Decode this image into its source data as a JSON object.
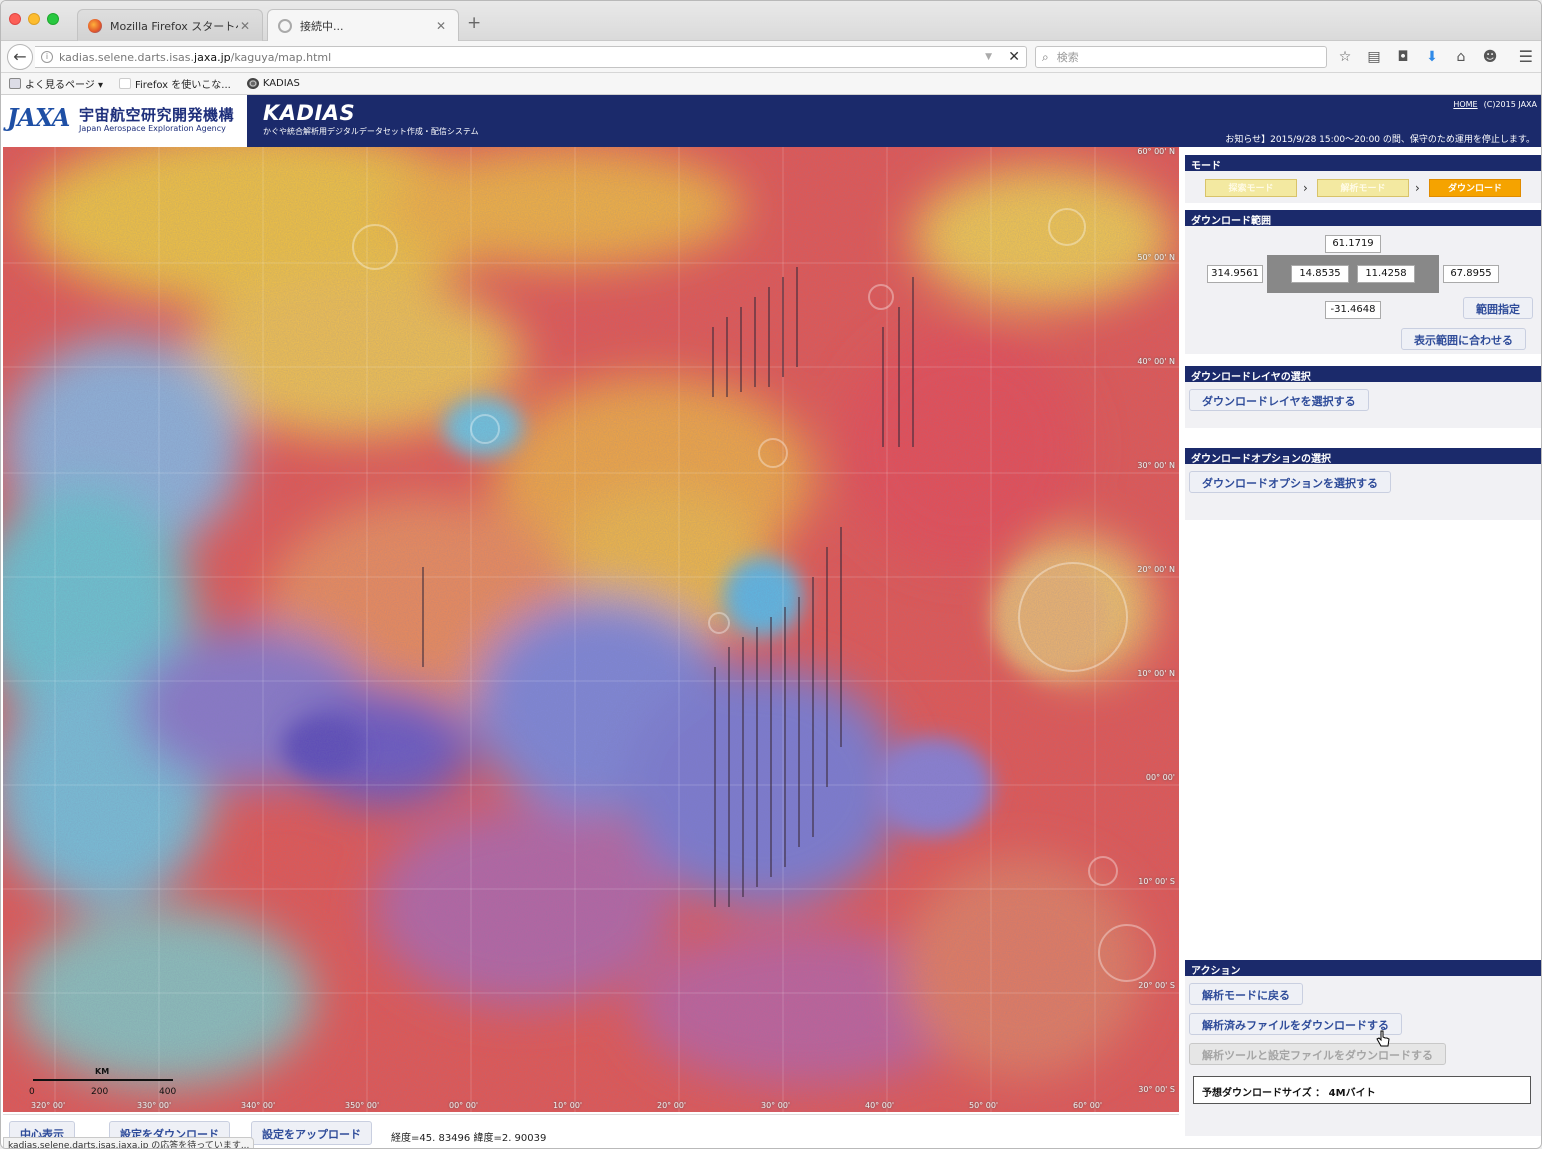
{
  "browser": {
    "tabs": [
      {
        "label": "Mozilla Firefox スタートページ"
      },
      {
        "label": "接続中..."
      }
    ],
    "url_prefix": "kadias.selene.darts.isas.",
    "url_domain": "jaxa.jp",
    "url_suffix": "/kaguya/map.html",
    "search_placeholder": "検索",
    "bookmarks": [
      "よく見るページ ▾",
      "Firefox を使いこな...",
      "KADIAS"
    ],
    "status_text": "kadias.selene.darts.isas.jaxa.jp の応答を待っています..."
  },
  "header": {
    "jaxa_jp": "宇宙航空研究開発機構",
    "jaxa_en": "Japan Aerospace Exploration Agency",
    "title": "KADIAS",
    "subtitle": "かぐや統合解析用デジタルデータセット作成・配信システム",
    "home_link": "HOME",
    "copyright": "(C)2015 JAXA",
    "notice": "お知らせ】2015/9/28 15:00～20:00 の間、保守のため運用を停止します。"
  },
  "map": {
    "lat_labels": [
      "60° 00' N",
      "50° 00' N",
      "40° 00' N",
      "30° 00' N",
      "20° 00' N",
      "10° 00' N",
      "00° 00'",
      "10° 00' S",
      "20° 00' S",
      "30° 00' S"
    ],
    "lon_labels": [
      "320° 00'",
      "330° 00'",
      "340° 00'",
      "350° 00'",
      "00° 00'",
      "10° 00'",
      "20° 00'",
      "30° 00'",
      "40° 00'",
      "50° 00'",
      "60° 00'"
    ],
    "scale_unit": "KM",
    "scale_ticks": [
      "0",
      "200",
      "400"
    ]
  },
  "bottom": {
    "center_btn": "中心表示",
    "download_settings_btn": "設定をダウンロード",
    "upload_settings_btn": "設定をアップロード",
    "coords": "経度=45. 83496  緯度=2. 90039"
  },
  "panel": {
    "mode_title": "モード",
    "modes": [
      "探索モード",
      "解析モード",
      "ダウンロード"
    ],
    "range_title": "ダウンロード範囲",
    "range": {
      "north": "61.1719",
      "west": "314.9561",
      "center_lon": "14.8535",
      "center_lat": "11.4258",
      "east": "67.8955",
      "south": "-31.4648"
    },
    "range_btn": "範囲指定",
    "fit_btn": "表示範囲に合わせる",
    "layer_title": "ダウンロードレイヤの選択",
    "layer_btn": "ダウンロードレイヤを選択する",
    "option_title": "ダウンロードオプションの選択",
    "option_btn": "ダウンロードオプションを選択する",
    "action_title": "アクション",
    "action_back": "解析モードに戻る",
    "action_download_files": "解析済みファイルをダウンロードする",
    "action_download_tools": "解析ツールと設定ファイルをダウンロードする",
    "size_label": "予想ダウンロードサイズ ： 4Mバイト"
  }
}
